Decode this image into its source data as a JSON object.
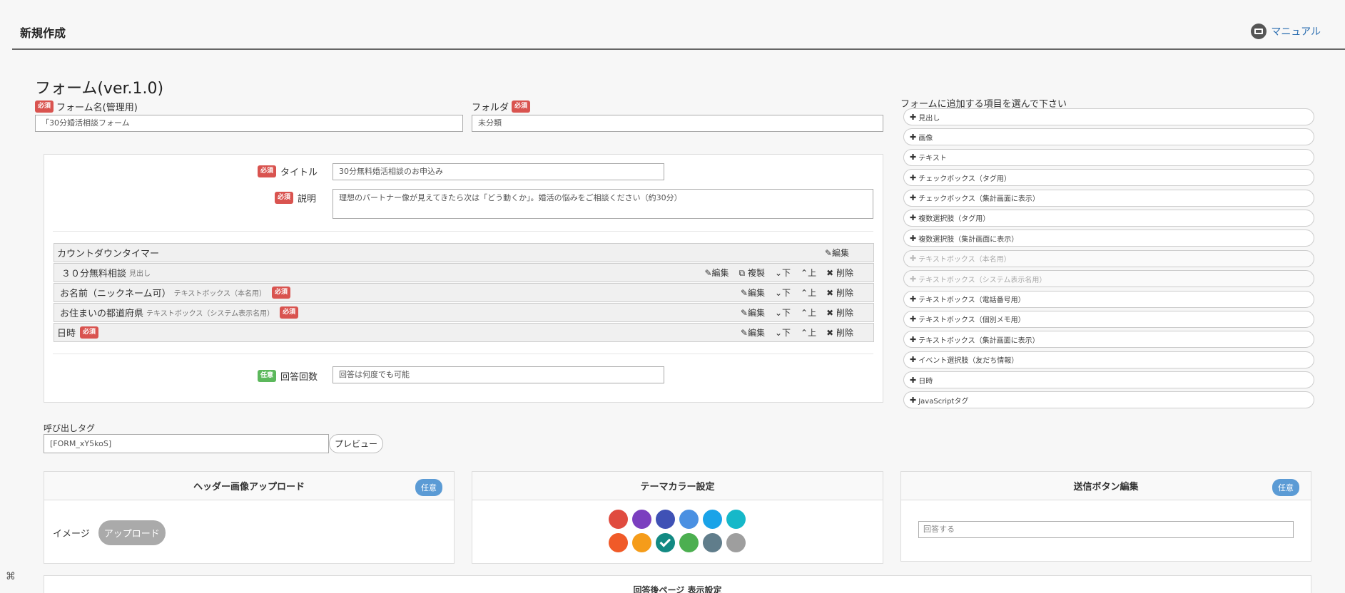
{
  "header": {
    "title": "新規作成",
    "manual_label": "マニュアル"
  },
  "form": {
    "title": "フォーム(ver.1.0)",
    "name_label": "フォーム名(管理用)",
    "name_value": "「30分婚活相談フォーム",
    "folder_label": "フォルダ",
    "folder_value": "未分類",
    "required_badge": "必須",
    "optional_badge": "任意"
  },
  "panel": {
    "title_label": "タイトル",
    "title_value": "30分無料婚活相談のお申込み",
    "desc_label": "説明",
    "desc_value": "理想のパートナー像が見えてきたら次は「どう動くか」。婚活の悩みをご相談ください（約30分）",
    "countdown_label": "カウントダウンタイマー",
    "countdown_edit": "編集",
    "items": [
      {
        "label": "３０分無料相談",
        "sub": "見出し",
        "required": false,
        "edit": "編集",
        "copy": "複製",
        "down": "下",
        "up": "上",
        "delete": "削除"
      },
      {
        "label": "お名前（ニックネーム可）",
        "sub": "テキストボックス（本名用）",
        "required": true,
        "edit": "編集",
        "down": "下",
        "up": "上",
        "delete": "削除"
      },
      {
        "label": "お住まいの都道府県",
        "sub": "テキストボックス（システム表示名用）",
        "required": true,
        "edit": "編集",
        "down": "下",
        "up": "上",
        "delete": "削除"
      },
      {
        "label": "日時",
        "sub": "",
        "required": true,
        "edit": "編集",
        "down": "下",
        "up": "上",
        "delete": "削除"
      }
    ],
    "answer_count_label": "回答回数",
    "answer_count_value": "回答は何度でも可能"
  },
  "sidebar": {
    "title": "フォームに追加する項目を選んで下さい",
    "items": [
      {
        "label": "見出し",
        "disabled": false
      },
      {
        "label": "画像",
        "disabled": false
      },
      {
        "label": "テキスト",
        "disabled": false
      },
      {
        "label": "チェックボックス（タグ用）",
        "disabled": false
      },
      {
        "label": "チェックボックス（集計画面に表示）",
        "disabled": false
      },
      {
        "label": "複数選択肢（タグ用）",
        "disabled": false
      },
      {
        "label": "複数選択肢（集計画面に表示）",
        "disabled": false
      },
      {
        "label": "テキストボックス（本名用）",
        "disabled": true
      },
      {
        "label": "テキストボックス（システム表示名用）",
        "disabled": true
      },
      {
        "label": "テキストボックス（電話番号用）",
        "disabled": false
      },
      {
        "label": "テキストボックス（個別メモ用）",
        "disabled": false
      },
      {
        "label": "テキストボックス（集計画面に表示）",
        "disabled": false
      },
      {
        "label": "イベント選択肢（友だち情報）",
        "disabled": false
      },
      {
        "label": "日時",
        "disabled": false
      },
      {
        "label": "JavaScriptタグ",
        "disabled": false
      }
    ]
  },
  "call_tag": {
    "label": "呼び出しタグ",
    "value": "[FORM_xY5koS]",
    "preview": "プレビュー"
  },
  "cards": {
    "header_upload": {
      "title": "ヘッダー画像アップロード",
      "badge": "任意",
      "image_label": "イメージ",
      "upload_label": "アップロード"
    },
    "theme": {
      "title": "テーマカラー設定",
      "colors": [
        "#e04b3f",
        "#7b3fbf",
        "#3f51b5",
        "#4a90e2",
        "#1aa3e8",
        "#16b8c9",
        "#f05a28",
        "#f59c1a",
        "#138a83",
        "#4caf50",
        "#607d8b",
        "#9e9e9e"
      ],
      "selected_index": 8
    },
    "submit": {
      "title": "送信ボタン編集",
      "badge": "任意",
      "placeholder": "回答する"
    }
  },
  "after_page": {
    "title": "回答後ページ 表示設定"
  }
}
